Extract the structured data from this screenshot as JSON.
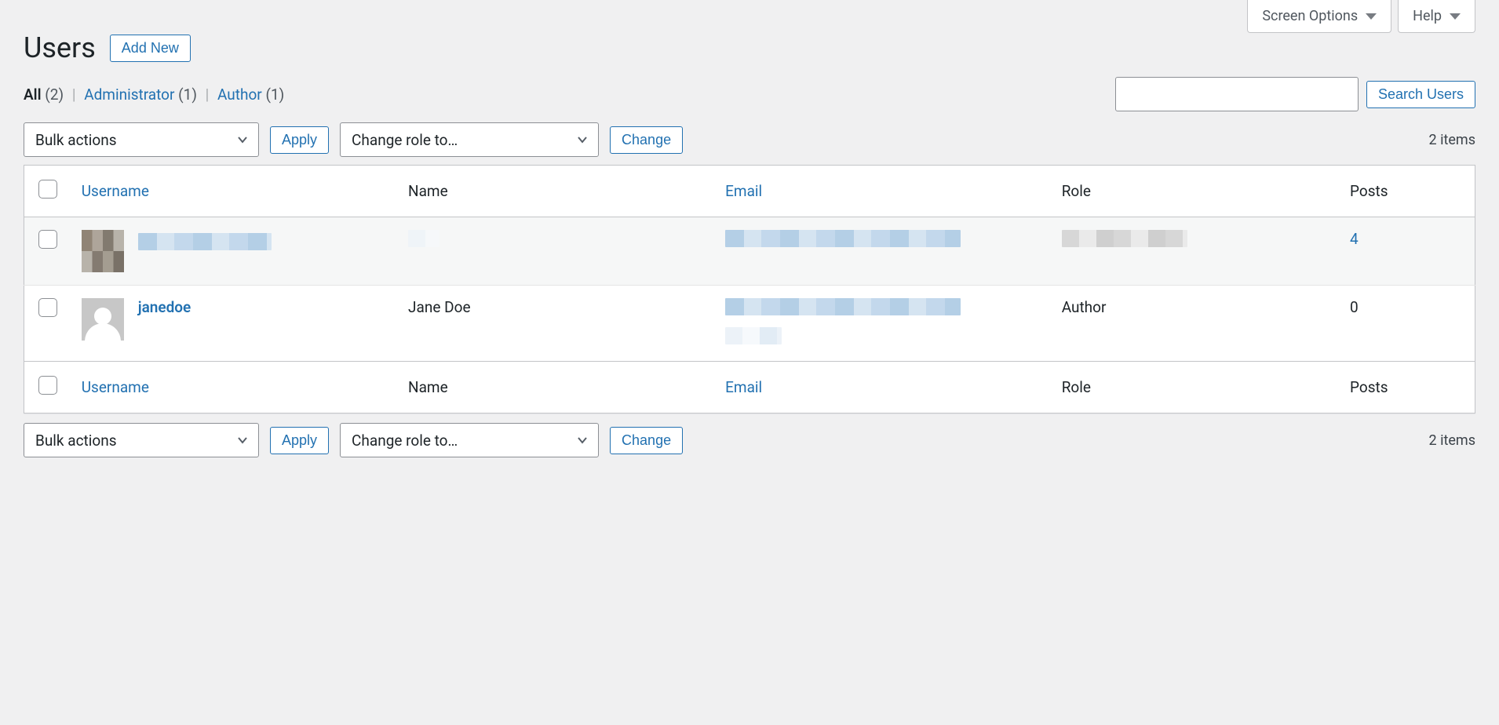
{
  "topTabs": {
    "screenOptions": "Screen Options",
    "help": "Help"
  },
  "header": {
    "title": "Users",
    "addNew": "Add New"
  },
  "filters": {
    "all": {
      "label": "All",
      "count": "(2)"
    },
    "administrator": {
      "label": "Administrator",
      "count": "(1)"
    },
    "author": {
      "label": "Author",
      "count": "(1)"
    }
  },
  "search": {
    "button": "Search Users",
    "placeholder": ""
  },
  "bulk": {
    "bulkActions": "Bulk actions",
    "apply": "Apply",
    "changeRole": "Change role to…",
    "change": "Change"
  },
  "itemsCount": "2 items",
  "columns": {
    "username": "Username",
    "name": "Name",
    "email": "Email",
    "role": "Role",
    "posts": "Posts"
  },
  "rows": [
    {
      "avatarType": "pixelated",
      "usernameRedacted": true,
      "nameRedacted": true,
      "emailRedacted": true,
      "roleRedacted": true,
      "posts": "4",
      "postsLink": true
    },
    {
      "avatarType": "mystery",
      "username": "janedoe",
      "name": "Jane Doe",
      "emailRedacted": true,
      "role": "Author",
      "posts": "0",
      "postsLink": false
    }
  ]
}
